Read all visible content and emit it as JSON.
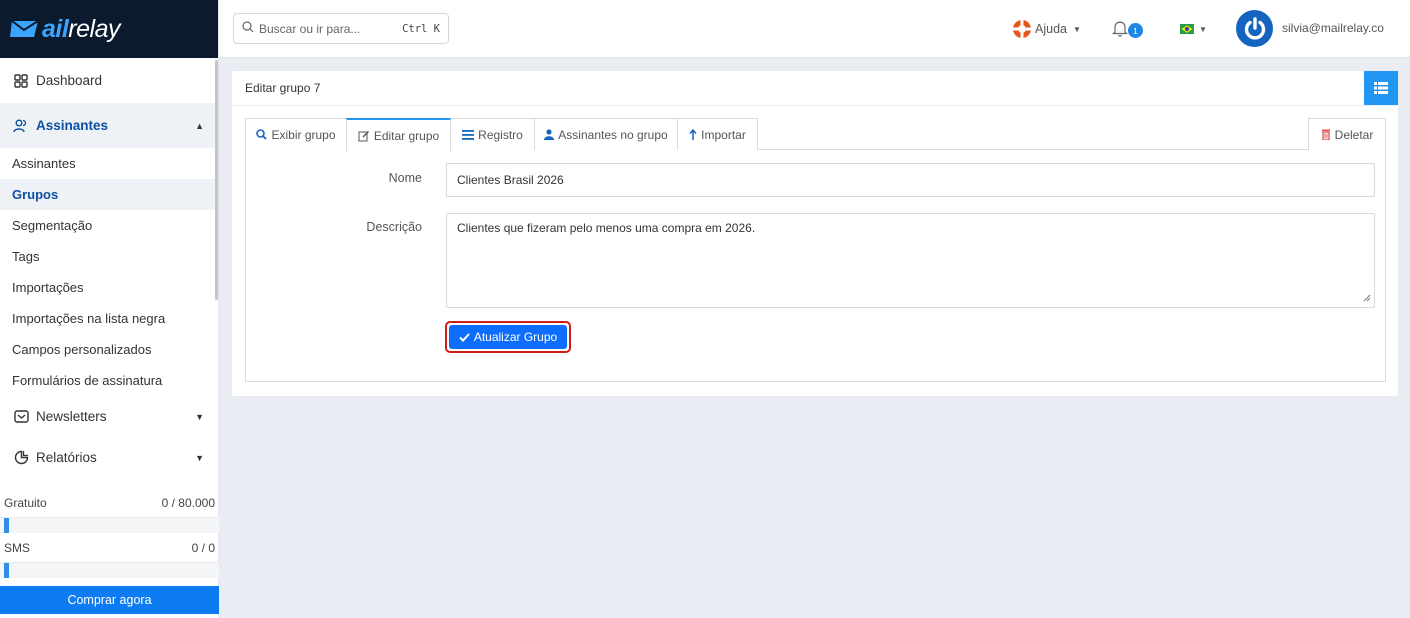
{
  "app": {
    "logo_text_a": "ail",
    "logo_text_b": "relay"
  },
  "search": {
    "placeholder": "Buscar ou ir para...",
    "shortcut": "Ctrl K"
  },
  "topbar": {
    "help_label": "Ajuda",
    "notification_count": "1",
    "user_email": "silvia@mailrelay.co"
  },
  "sidebar": {
    "dashboard": "Dashboard",
    "subscribers_section": "Assinantes",
    "sub_items": [
      "Assinantes",
      "Grupos",
      "Segmentação",
      "Tags",
      "Importações",
      "Importações na lista negra",
      "Campos personalizados",
      "Formulários de assinatura"
    ],
    "newsletters": "Newsletters",
    "reports": "Relatórios"
  },
  "quota": {
    "free_label": "Gratuito",
    "free_value": "0 / 80.000",
    "free_fraction": 0.0,
    "sms_label": "SMS",
    "sms_value": "0 / 0",
    "sms_fraction": 0.0,
    "buy_label": "Comprar agora"
  },
  "panel": {
    "title": "Editar grupo 7",
    "tabs": {
      "view": "Exibir grupo",
      "edit": "Editar grupo",
      "log": "Registro",
      "subscribers": "Assinantes no grupo",
      "import": "Importar",
      "delete": "Deletar"
    },
    "form": {
      "name_label": "Nome",
      "name_value": "Clientes Brasil 2026",
      "description_label": "Descrição",
      "description_value": "Clientes que fizeram pelo menos uma compra em 2026.",
      "submit_label": "Atualizar Grupo"
    }
  },
  "colors": {
    "accent": "#2196f3",
    "primary_button": "#0d6efd",
    "sidebar_header": "#0c1a2e",
    "highlight_border": "#d21c1c"
  }
}
